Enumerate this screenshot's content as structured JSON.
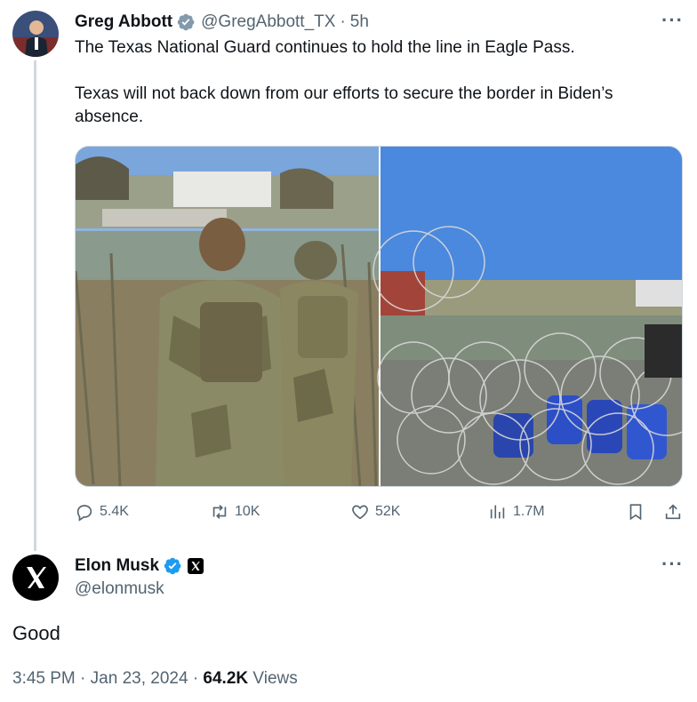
{
  "tweet": {
    "author_name": "Greg Abbott",
    "handle": "@GregAbbott_TX",
    "separator": "·",
    "time": "5h",
    "text_line1": "The Texas National Guard continues to hold the line in Eagle Pass.",
    "text_line2": "Texas will not back down from our efforts to secure the border in Biden’s absence.",
    "more": "···",
    "actions": {
      "replies": "5.4K",
      "retweets": "10K",
      "likes": "52K",
      "views": "1.7M"
    }
  },
  "reply": {
    "author_name": "Elon Musk",
    "handle": "@elonmusk",
    "more": "···",
    "text": "Good",
    "time": "3:45 PM",
    "date": "Jan 23, 2024",
    "dot1": "·",
    "dot2": "·",
    "views_count": "64.2K",
    "views_label": "Views"
  },
  "colors": {
    "verified_blue": "#1d9bf0",
    "verified_gray": "#829aab",
    "secondary_text": "#536471"
  },
  "icons": [
    "verified-badge-icon",
    "more-icon",
    "reply-icon",
    "retweet-icon",
    "like-icon",
    "views-icon",
    "bookmark-icon",
    "share-icon",
    "x-logo-icon"
  ]
}
